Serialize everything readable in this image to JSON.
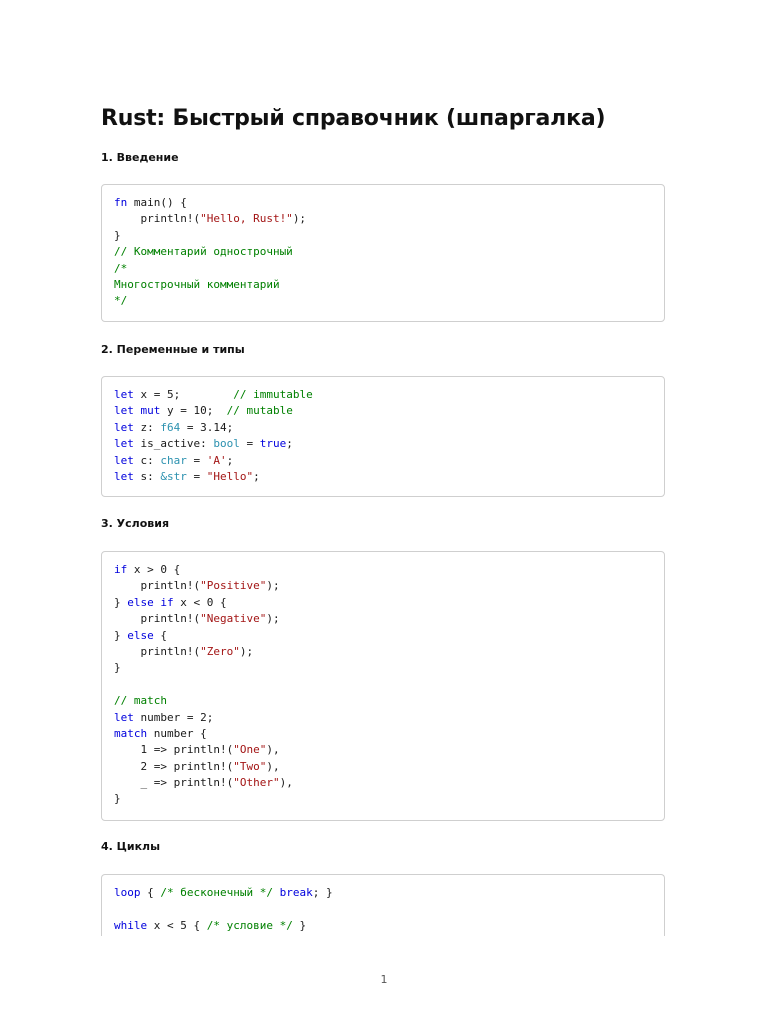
{
  "document": {
    "title": "Rust: Быстрый справочник (шпаргалка)",
    "page_number": "1"
  },
  "colors": {
    "keyword": "#0000dd",
    "type": "#2b91af",
    "string": "#a31515",
    "comment": "#008000",
    "text": "#1a1a1a",
    "border": "#cfcfcf"
  },
  "sections": [
    {
      "heading": "1. Введение",
      "lines": [
        [
          [
            "kw",
            "fn"
          ],
          [
            "p",
            " main() {"
          ]
        ],
        [
          [
            "p",
            "    println!("
          ],
          [
            "str",
            "\"Hello, Rust!\""
          ],
          [
            "p",
            ");"
          ]
        ],
        [
          [
            "p",
            "}"
          ]
        ],
        [
          [
            "com",
            "// Комментарий однострочный"
          ]
        ],
        [
          [
            "com",
            "/*"
          ]
        ],
        [
          [
            "com",
            "Многострочный комментарий"
          ]
        ],
        [
          [
            "com",
            "*/"
          ]
        ]
      ]
    },
    {
      "heading": "2. Переменные и типы",
      "lines": [
        [
          [
            "kw",
            "let"
          ],
          [
            "p",
            " x = 5;        "
          ],
          [
            "com",
            "// immutable"
          ]
        ],
        [
          [
            "kw",
            "let"
          ],
          [
            "p",
            " "
          ],
          [
            "kw",
            "mut"
          ],
          [
            "p",
            " y = 10;  "
          ],
          [
            "com",
            "// mutable"
          ]
        ],
        [
          [
            "kw",
            "let"
          ],
          [
            "p",
            " z: "
          ],
          [
            "type",
            "f64"
          ],
          [
            "p",
            " = 3.14;"
          ]
        ],
        [
          [
            "kw",
            "let"
          ],
          [
            "p",
            " is_active: "
          ],
          [
            "type",
            "bool"
          ],
          [
            "p",
            " = "
          ],
          [
            "kw",
            "true"
          ],
          [
            "p",
            ";"
          ]
        ],
        [
          [
            "kw",
            "let"
          ],
          [
            "p",
            " c: "
          ],
          [
            "type",
            "char"
          ],
          [
            "p",
            " = "
          ],
          [
            "str",
            "'A'"
          ],
          [
            "p",
            ";"
          ]
        ],
        [
          [
            "kw",
            "let"
          ],
          [
            "p",
            " s: "
          ],
          [
            "type",
            "&str"
          ],
          [
            "p",
            " = "
          ],
          [
            "str",
            "\"Hello\""
          ],
          [
            "p",
            ";"
          ]
        ]
      ]
    },
    {
      "heading": "3. Условия",
      "lines": [
        [
          [
            "kw",
            "if"
          ],
          [
            "p",
            " x > 0 {"
          ]
        ],
        [
          [
            "p",
            "    println!("
          ],
          [
            "str",
            "\"Positive\""
          ],
          [
            "p",
            ");"
          ]
        ],
        [
          [
            "p",
            "} "
          ],
          [
            "kw",
            "else if"
          ],
          [
            "p",
            " x < 0 {"
          ]
        ],
        [
          [
            "p",
            "    println!("
          ],
          [
            "str",
            "\"Negative\""
          ],
          [
            "p",
            ");"
          ]
        ],
        [
          [
            "p",
            "} "
          ],
          [
            "kw",
            "else"
          ],
          [
            "p",
            " {"
          ]
        ],
        [
          [
            "p",
            "    println!("
          ],
          [
            "str",
            "\"Zero\""
          ],
          [
            "p",
            ");"
          ]
        ],
        [
          [
            "p",
            "}"
          ]
        ],
        [
          [
            "p",
            ""
          ]
        ],
        [
          [
            "com",
            "// match"
          ]
        ],
        [
          [
            "kw",
            "let"
          ],
          [
            "p",
            " number = 2;"
          ]
        ],
        [
          [
            "kw",
            "match"
          ],
          [
            "p",
            " number {"
          ]
        ],
        [
          [
            "p",
            "    1 => println!("
          ],
          [
            "str",
            "\"One\""
          ],
          [
            "p",
            "),"
          ]
        ],
        [
          [
            "p",
            "    2 => println!("
          ],
          [
            "str",
            "\"Two\""
          ],
          [
            "p",
            "),"
          ]
        ],
        [
          [
            "p",
            "    _ => println!("
          ],
          [
            "str",
            "\"Other\""
          ],
          [
            "p",
            "),"
          ]
        ],
        [
          [
            "p",
            "}"
          ]
        ]
      ]
    },
    {
      "heading": "4. Циклы",
      "lines": [
        [
          [
            "kw",
            "loop"
          ],
          [
            "p",
            " { "
          ],
          [
            "com",
            "/* бесконечный */"
          ],
          [
            "p",
            " "
          ],
          [
            "kw",
            "break"
          ],
          [
            "p",
            "; }"
          ]
        ],
        [
          [
            "p",
            ""
          ]
        ],
        [
          [
            "kw",
            "while"
          ],
          [
            "p",
            " x < 5 { "
          ],
          [
            "com",
            "/* условие */"
          ],
          [
            "p",
            " }"
          ]
        ]
      ]
    }
  ]
}
